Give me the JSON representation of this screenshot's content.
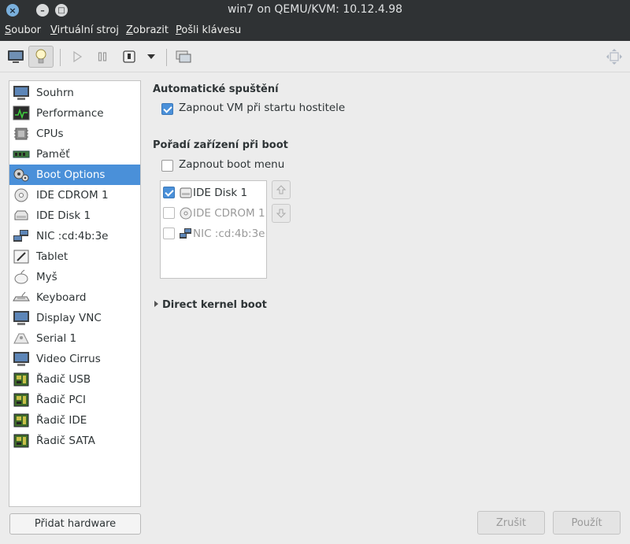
{
  "window": {
    "title": "win7 on QEMU/KVM: 10.12.4.98",
    "close_glyph": "×",
    "min_glyph": "–",
    "max_glyph": "□"
  },
  "menu": [
    {
      "label": "Soubor"
    },
    {
      "label": "Virtuální stroj"
    },
    {
      "label": "Zobrazit"
    },
    {
      "label": "Pošli klávesu"
    }
  ],
  "toolbar": {
    "buttons": [
      "console-icon",
      "details-lightbulb-icon",
      "run-icon",
      "pause-icon",
      "shutdown-icon",
      "dropdown-arrow-icon",
      "snapshot-icon",
      "fullscreen-icon"
    ],
    "active": "details-lightbulb-icon"
  },
  "sidebar": {
    "items": [
      {
        "label": "Souhrn",
        "icon": "monitor-icon"
      },
      {
        "label": "Performance",
        "icon": "performance-icon"
      },
      {
        "label": "CPUs",
        "icon": "cpu-icon"
      },
      {
        "label": "Paměť",
        "icon": "memory-icon"
      },
      {
        "label": "Boot Options",
        "icon": "boot-options-icon"
      },
      {
        "label": "IDE CDROM 1",
        "icon": "cdrom-icon"
      },
      {
        "label": "IDE Disk 1",
        "icon": "disk-icon"
      },
      {
        "label": "NIC :cd:4b:3e",
        "icon": "network-icon"
      },
      {
        "label": "Tablet",
        "icon": "tablet-icon"
      },
      {
        "label": "Myš",
        "icon": "mouse-icon"
      },
      {
        "label": "Keyboard",
        "icon": "keyboard-icon"
      },
      {
        "label": "Display VNC",
        "icon": "display-icon"
      },
      {
        "label": "Serial 1",
        "icon": "serial-icon"
      },
      {
        "label": "Video Cirrus",
        "icon": "video-icon"
      },
      {
        "label": "Řadič USB",
        "icon": "controller-icon"
      },
      {
        "label": "Řadič PCI",
        "icon": "controller-icon"
      },
      {
        "label": "Řadič IDE",
        "icon": "controller-icon"
      },
      {
        "label": "Řadič SATA",
        "icon": "controller-icon"
      }
    ],
    "selected": "Boot Options",
    "add_button": "Přidat hardware"
  },
  "main": {
    "autostart_title": "Automatické spuštění",
    "autostart_checkbox": "Zapnout VM při startu hostitele",
    "autostart_checked": true,
    "boot_order_title": "Pořadí zařízení při boot",
    "boot_menu_checkbox": "Zapnout boot menu",
    "boot_menu_checked": false,
    "boot_devices": [
      {
        "label": "IDE Disk 1",
        "checked": true,
        "enabled": true,
        "icon": "disk-icon"
      },
      {
        "label": "IDE CDROM 1",
        "checked": false,
        "enabled": false,
        "icon": "cdrom-icon"
      },
      {
        "label": "NIC :cd:4b:3e",
        "checked": false,
        "enabled": false,
        "icon": "network-icon"
      }
    ],
    "direct_kernel_boot": "Direct kernel boot"
  },
  "footer": {
    "cancel": "Zrušit",
    "apply": "Použít"
  }
}
